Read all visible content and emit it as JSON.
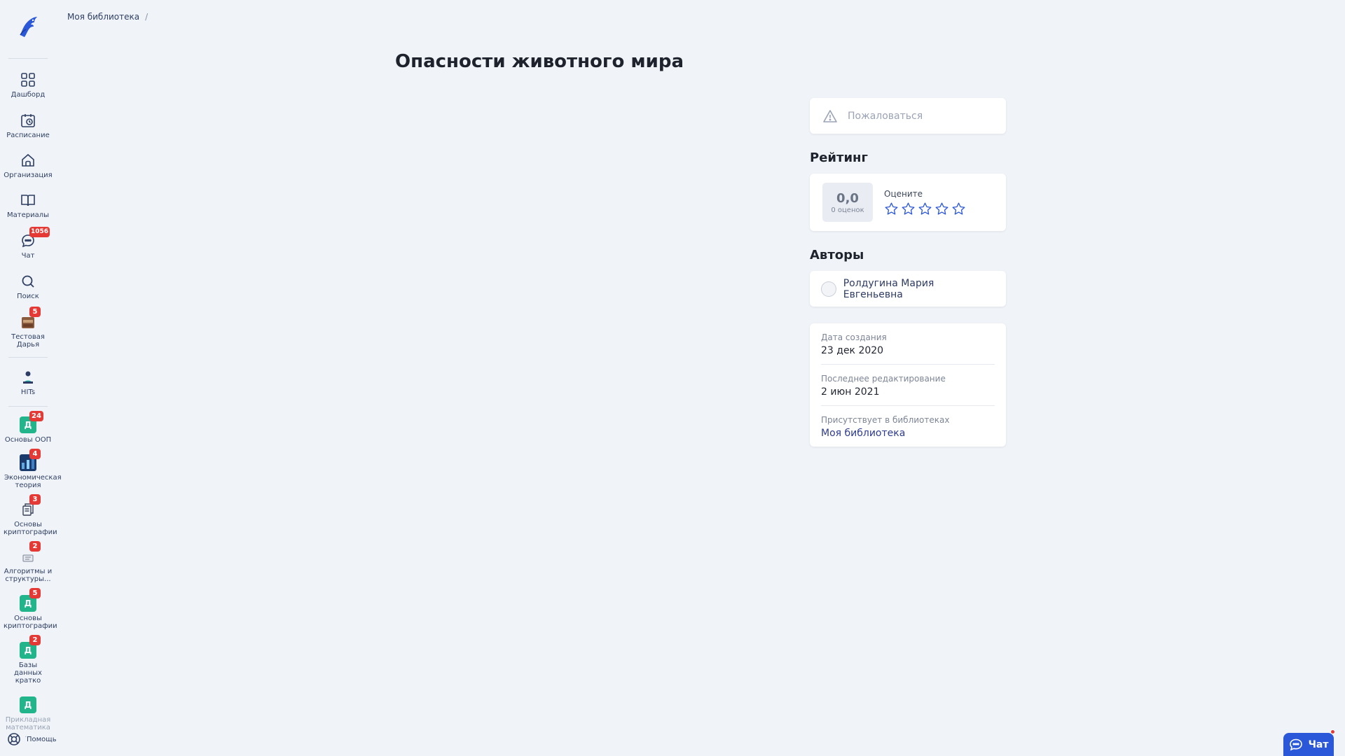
{
  "breadcrumb": {
    "home": "Моя библиотека",
    "separator": "/"
  },
  "page": {
    "title": "Опасности животного мира"
  },
  "nav": [
    {
      "label": "Дашборд",
      "icon": "grid-icon"
    },
    {
      "label": "Расписание",
      "icon": "calendar-icon"
    },
    {
      "label": "Организация",
      "icon": "home-icon"
    },
    {
      "label": "Материалы",
      "icon": "book-icon"
    },
    {
      "label": "Чат",
      "icon": "chat-icon",
      "badge": "1056"
    },
    {
      "label": "Поиск",
      "icon": "search-icon"
    },
    {
      "label": "Тестовая Дарья",
      "icon": "avatar-icon",
      "badge": "5"
    }
  ],
  "hits": {
    "label": "HITs"
  },
  "courses": [
    {
      "label": "Основы ООП",
      "tile": "Д",
      "badge": "24"
    },
    {
      "label": "Экономическая теория",
      "badge": "4"
    },
    {
      "label": "Основы криптографии",
      "badge": "3"
    },
    {
      "label": "Алгоритмы и структуры...",
      "badge": "2"
    },
    {
      "label": "Основы криптографии",
      "tile": "Д",
      "badge": "5"
    },
    {
      "label": "Базы данных кратко",
      "tile": "Д",
      "badge": "2"
    },
    {
      "label": "Прикладная математика ...",
      "tile": "Д"
    }
  ],
  "help": {
    "label": "Помощь"
  },
  "complaint": {
    "label": "Пожаловаться"
  },
  "rating": {
    "section_title": "Рейтинг",
    "score": "0,0",
    "count": "0 оценок",
    "rate_label": "Оцените",
    "stars_total": 5,
    "stars_filled": 0
  },
  "authors": {
    "section_title": "Авторы",
    "items": [
      {
        "name": "Ролдугина Мария Евгеньевна"
      }
    ]
  },
  "info": {
    "created_label": "Дата создания",
    "created_value": "23 дек 2020",
    "edited_label": "Последнее редактирование",
    "edited_value": "2 июн 2021",
    "libraries_label": "Присутствует в библиотеках",
    "libraries_value": "Моя библиотека"
  },
  "chat_button": {
    "label": "Чат"
  },
  "colors": {
    "accent": "#2b57d9",
    "badge": "#e53935",
    "tile": "#22b58c",
    "background": "#f0f4f8"
  }
}
